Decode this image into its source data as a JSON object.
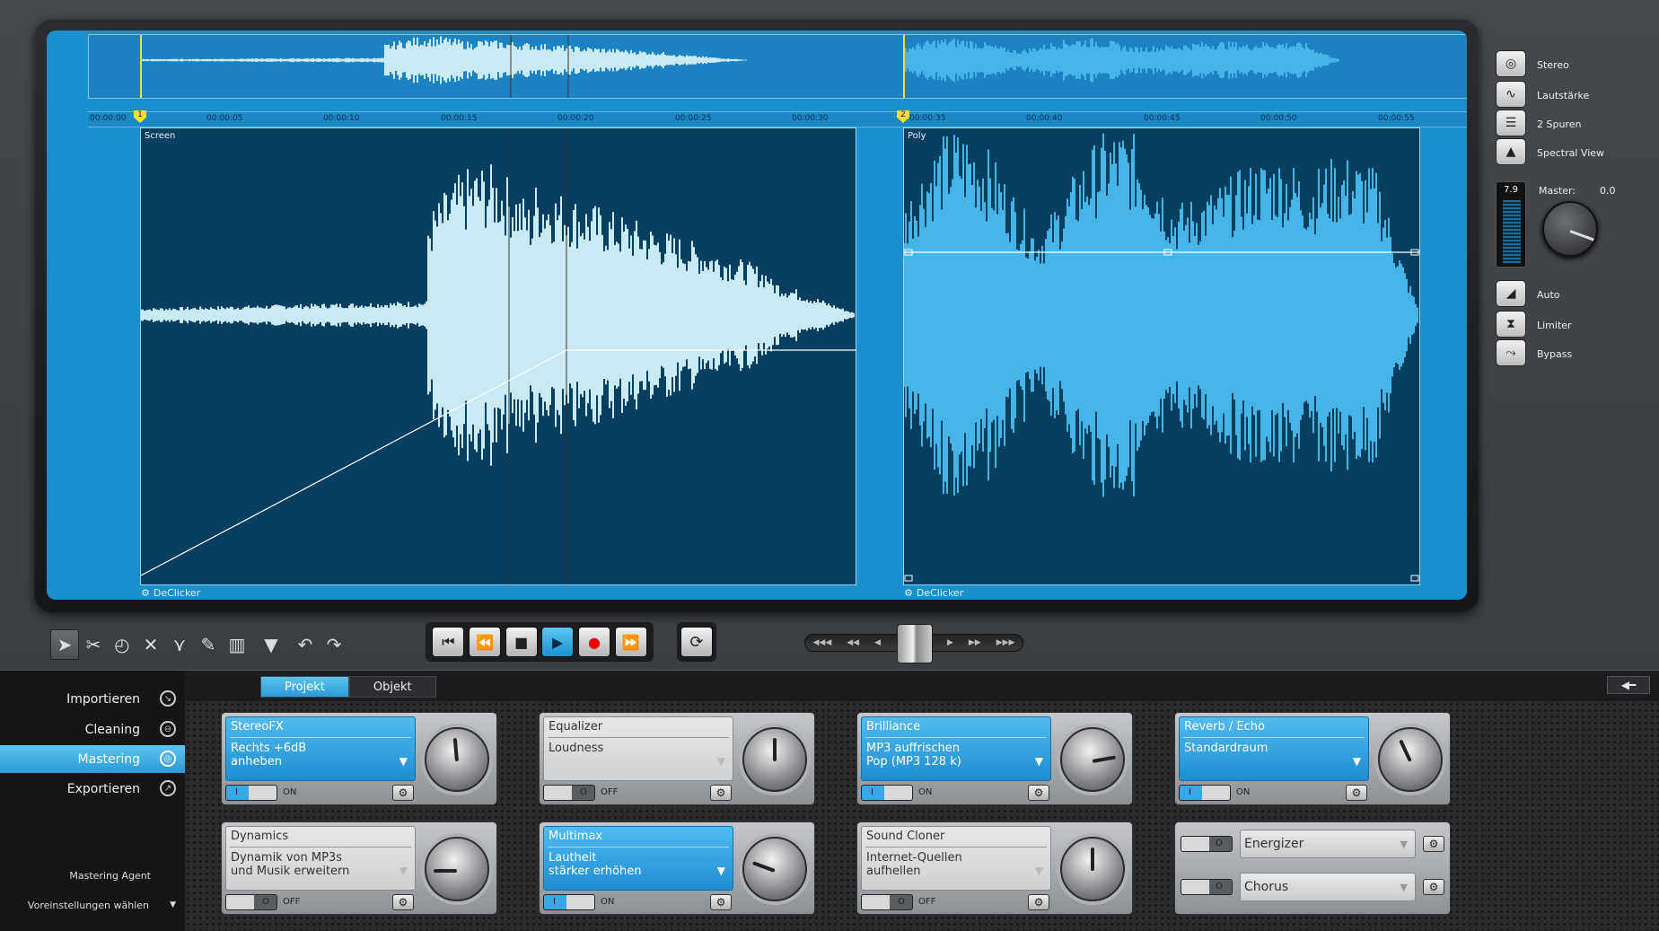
{
  "right_panel": {
    "items": [
      {
        "label": "Stereo",
        "icon": "stereo-icon"
      },
      {
        "label": "Lautstärke",
        "icon": "volume-curve-icon"
      },
      {
        "label": "2 Spuren",
        "icon": "two-tracks-icon"
      },
      {
        "label": "Spectral View",
        "icon": "spectrum-icon"
      }
    ],
    "meter_value": "7.9",
    "master_label": "Master:",
    "master_value": "0.0",
    "bottom_items": [
      {
        "label": "Auto",
        "icon": "auto-icon"
      },
      {
        "label": "Limiter",
        "icon": "limiter-icon"
      },
      {
        "label": "Bypass",
        "icon": "bypass-icon"
      }
    ]
  },
  "timeline": {
    "ticks": [
      "00:00:00",
      "00:00:05",
      "00:00:10",
      "00:00:15",
      "00:00:20",
      "00:00:25",
      "00:00:30",
      "00:00:35",
      "00:00:40",
      "00:00:45",
      "00:00:50",
      "00:00:55"
    ],
    "markers": [
      "1",
      "2"
    ]
  },
  "clips": [
    {
      "name": "Screen",
      "fx": "DeClicker",
      "color": "#c9e9f3"
    },
    {
      "name": "Poly",
      "fx": "DeClicker",
      "color": "#45b4e6"
    }
  ],
  "nav": {
    "items": [
      {
        "label": "Importieren",
        "active": false
      },
      {
        "label": "Cleaning",
        "active": false
      },
      {
        "label": "Mastering",
        "active": true
      },
      {
        "label": "Exportieren",
        "active": false
      }
    ],
    "agent_label": "Mastering Agent",
    "preset_label": "Voreinstellungen wählen"
  },
  "tabs": [
    {
      "label": "Projekt",
      "active": true
    },
    {
      "label": "Objekt",
      "active": false
    }
  ],
  "modules": [
    {
      "title": "StereoFX",
      "desc": "Rechts +6dB\nanheben",
      "state": "ON",
      "on": true
    },
    {
      "title": "Equalizer",
      "desc": "Loudness",
      "state": "OFF",
      "on": false
    },
    {
      "title": "Brilliance",
      "desc": "MP3 auffrischen\nPop (MP3 128 k)",
      "state": "ON",
      "on": true
    },
    {
      "title": "Reverb / Echo",
      "desc": "Standardraum",
      "state": "ON",
      "on": true
    },
    {
      "title": "Dynamics",
      "desc": "Dynamik von MP3s\nund Musik erweitern",
      "state": "OFF",
      "on": false
    },
    {
      "title": "Multimax",
      "desc": "Lautheit\nstärker erhöhen",
      "state": "ON",
      "on": true
    },
    {
      "title": "Sound Cloner",
      "desc": "Internet-Quellen\naufhellen",
      "state": "OFF",
      "on": false
    }
  ],
  "mini_modules": [
    {
      "label": "Energizer"
    },
    {
      "label": "Chorus"
    }
  ],
  "colors": {
    "accent": "#2b9ad6",
    "screen": "#1b8ecc",
    "clip_bg": "#083e60"
  }
}
